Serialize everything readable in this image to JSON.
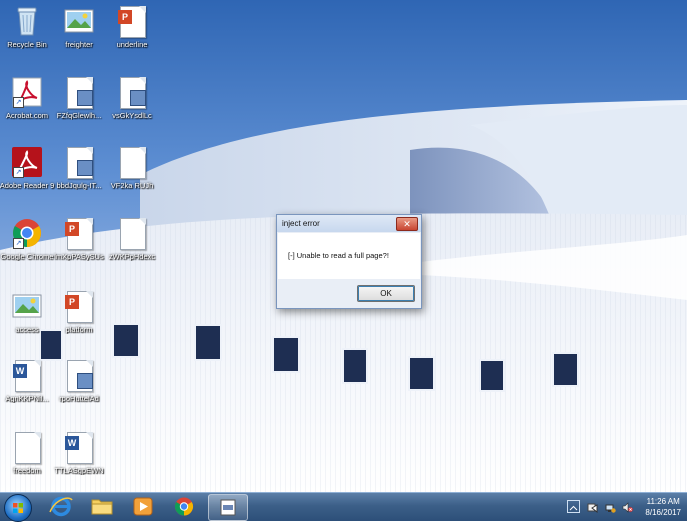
{
  "desktop_icons": [
    {
      "label": "Recycle Bin",
      "icon": "recycle-bin-icon"
    },
    {
      "label": "freighter",
      "icon": "image-file-icon"
    },
    {
      "label": "underline",
      "icon": "powerpoint-file-icon"
    },
    {
      "label": "Acrobat.com",
      "icon": "acrobat-icon"
    },
    {
      "label": "FZfqGlewlh...",
      "icon": "generic-file-icon"
    },
    {
      "label": "vsGkYsdlLc",
      "icon": "generic-file-icon"
    },
    {
      "label": "Adobe Reader 9",
      "icon": "adobe-reader-icon"
    },
    {
      "label": "bbdJqulg-IT...",
      "icon": "generic-file-icon"
    },
    {
      "label": "VF2ka RUJh",
      "icon": "blank-file-icon"
    },
    {
      "label": "Google Chrome",
      "icon": "chrome-icon"
    },
    {
      "label": "lmXpPASySUs",
      "icon": "powerpoint-file-icon"
    },
    {
      "label": "zWKPpHdexc",
      "icon": "blank-file-icon"
    },
    {
      "label": "access",
      "icon": "image-file-icon"
    },
    {
      "label": "platform",
      "icon": "powerpoint-file-icon"
    },
    {
      "label": "AgnKKPNil...",
      "icon": "word-file-icon"
    },
    {
      "label": "rpoHuttelAd",
      "icon": "generic-file-icon"
    },
    {
      "label": "freedom",
      "icon": "blank-file-icon"
    },
    {
      "label": "TTLASgpEWN",
      "icon": "word-file-icon"
    }
  ],
  "dialog": {
    "title": "inject error",
    "message": "[-] Unable to read a full page?!",
    "ok_label": "OK",
    "close_glyph": "✕"
  },
  "taskbar": {
    "items": [
      "start-button",
      "internet-explorer-icon",
      "file-explorer-icon",
      "media-player-icon",
      "chrome-icon",
      "active-window-icon"
    ],
    "time": "11:26 AM",
    "date": "8/16/2017"
  }
}
